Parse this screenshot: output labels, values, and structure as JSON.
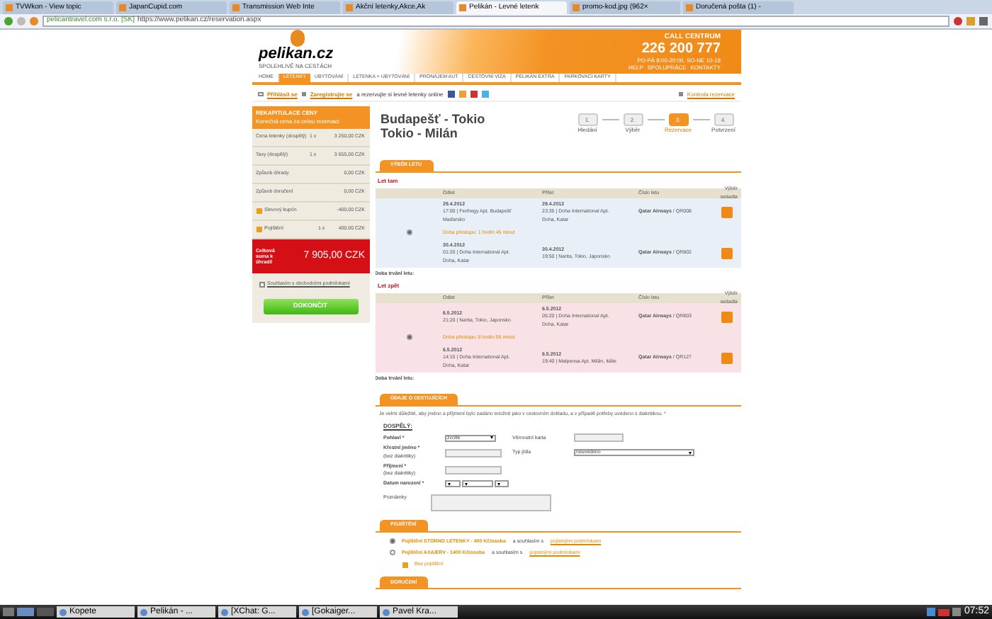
{
  "browser": {
    "tabs": [
      {
        "title": "TVWkon - View topic",
        "selected": false
      },
      {
        "title": "JapanCupid.com",
        "selected": false
      },
      {
        "title": "Transmission Web Inte",
        "selected": false
      },
      {
        "title": "Akční letenky,Akce,Ak",
        "selected": false
      },
      {
        "title": "Pelikán - Levné letenk",
        "selected": true
      },
      {
        "title": "promo-kod.jpg (962×",
        "selected": false
      },
      {
        "title": "Doručená pošta (1) -",
        "selected": false
      }
    ],
    "site_identity": "pelicantravel.com s.r.o. [SK]",
    "url": "https://www.pelikan.cz/reservation.aspx"
  },
  "header": {
    "logo": "pelikan.cz",
    "tagline": "SPOLEHLIVĚ NA CESTÁCH",
    "call_label": "CALL CENTRUM",
    "phone": "226 200 777",
    "hours": "PO-PÁ 8:00-20:00, SO-NE 10-18",
    "links": [
      "HELP",
      "SPOLUPRÁCE",
      "KONTAKTY"
    ]
  },
  "nav": [
    {
      "label": "HOME",
      "selected": false
    },
    {
      "label": "LETENKY",
      "selected": true
    },
    {
      "label": "UBYTOVÁNÍ",
      "selected": false
    },
    {
      "label": "LETENKA + UBYTOVÁNÍ",
      "selected": false
    },
    {
      "label": "PRONÁJEM AUT",
      "selected": false
    },
    {
      "label": "CESTOVNÍ VÍZA",
      "selected": false
    },
    {
      "label": "PELIKÁN EXTRA",
      "selected": false
    },
    {
      "label": "PARKOVACÍ KARTY",
      "selected": false
    }
  ],
  "subbar": {
    "login": "Přihlásit se",
    "register": "Zaregistrujte se",
    "register_text": "a rezervujte si levné letenky online",
    "check": "Kontrola rezervace"
  },
  "summary": {
    "title": "REKAPITULACE CENY",
    "subtitle": "Konečná cena za celou rezervaci",
    "rows": [
      {
        "label": "Cena letenky (dospělý)",
        "qty": "1 x",
        "amount": "3 250,00 CZK",
        "icon": false
      },
      {
        "label": "Taxy (dospělý)",
        "qty": "1 x",
        "amount": "3 655,00 CZK",
        "icon": false
      },
      {
        "label": "Způsob úhrady",
        "amount": "0,00 CZK",
        "icon": false
      },
      {
        "label": "Způsob doručení",
        "amount": "0,00 CZK",
        "icon": false
      },
      {
        "label": "Slevový kupón",
        "amount": "-400,00 CZK",
        "icon": true
      },
      {
        "label": "Pojištění",
        "qty": "1 x",
        "amount": "400,00 CZK",
        "icon": true
      }
    ],
    "total_label": "Celková suma k úhradě",
    "total": "7 905,00 CZK",
    "terms": "Souhlasím s obchodními podmínkami",
    "terms_checked": false,
    "button": "DOKONČIT"
  },
  "route": [
    "Budapešť - Tokio",
    "Tokio - Milán"
  ],
  "steps": [
    {
      "number": "1.",
      "label": "Hledání",
      "selected": false
    },
    {
      "number": "2.",
      "label": "Výběr",
      "selected": false
    },
    {
      "number": "3.",
      "label": "Rezervace",
      "selected": true
    },
    {
      "number": "4.",
      "label": "Potvrzení",
      "selected": false
    }
  ],
  "flight_section": "VÝBĚR LETU",
  "flights": [
    {
      "heading": "Let tam",
      "color": "#e9eff6",
      "selected": true,
      "columns": [
        "Odlet",
        "Přílet",
        "Číslo letu",
        "Výběr sedadla"
      ],
      "segments": [
        {
          "dep_date": "29.4.2012",
          "dep": "17:00 | Ferihegy Apt. Budapešť Maďarsko",
          "arr_date": "29.4.2012",
          "arr": "23:35 | Doha International Apt. Doha, Katar",
          "airline": "Qatar Airways",
          "number": "/ QR008"
        },
        {
          "dep_date": "30.4.2012",
          "dep": "01:20 | Doha International Apt. Doha, Katar",
          "arr_date": "30.4.2012",
          "arr": "19:50 | Narita, Tokio, Japonsko",
          "airline": "Qatar Airways",
          "number": "/ QR802"
        }
      ],
      "transfer": "Doba přestupu: 1 hodin 45 minut",
      "duration": "Doba trvání letu:"
    },
    {
      "heading": "Let zpět",
      "color": "#f9e2e5",
      "selected": true,
      "columns": [
        "Odlet",
        "Přílet",
        "Číslo letu",
        "Výběr sedadla"
      ],
      "segments": [
        {
          "dep_date": "6.5.2012",
          "dep": "21:20 | Narita, Tokio, Japonsko",
          "arr_date": "6.5.2012",
          "arr": "05:20 | Doha International Apt. Doha, Katar",
          "airline": "Qatar Airways",
          "number": "/ QR803"
        },
        {
          "dep_date": "6.5.2012",
          "dep": "14:15 | Doha International Apt. Doha, Katar",
          "arr_date": "6.5.2012",
          "arr": "19:40 | Malpensa Apt. Milán, Itálie",
          "airline": "Qatar Airways",
          "number": "/ QR127"
        }
      ],
      "transfer": "Doba přestupu: 8 hodin 55 minut",
      "duration": "Doba trvání letu:"
    }
  ],
  "passenger_section": "ÚDAJE O CESTUJÍCÍCH",
  "note": "Je velmi důležité, aby jméno a příjmení bylo zadáno totožně jako v cestovním dokladu, a v případě potřeby uvedeno s diakritikou. *",
  "passenger_type": "DOSPĚLÝ:",
  "form": {
    "gender_label": "Pohlaví *",
    "gender_value": "zvolte",
    "first_label": "Křestní jméno *",
    "first_hint": "(bez diakritiky)",
    "last_label": "Příjmení *",
    "last_hint": "(bez diakritiky)",
    "birth_label": "Datum narození *",
    "card_label": "Věrnostní karta",
    "meal_label": "Typ jídla",
    "meal_value": "neuvedeno",
    "notes_label": "Poznámky"
  },
  "insurance_section": "POJIŠTĚNÍ",
  "insurance": [
    {
      "kind": "radio",
      "text": "Pojištění STORNO LETENKY - 400 Kč/osoba",
      "suffix": "a souhlasím s",
      "link": "pojistnými podmínkami",
      "selected": true
    },
    {
      "kind": "radio",
      "text": "Pojištění AXA/ERV - 1400 Kč/osoba",
      "suffix": "a souhlasím s",
      "link": "pojistnými podmínkami",
      "selected": false
    },
    {
      "kind": "icon",
      "text": "Bez pojištění"
    }
  ],
  "next_section": "DORUČENÍ",
  "taskbar": {
    "items": [
      "Kopete",
      "Pelikán - ...",
      "[XChat: G...",
      "[Gokaiger...",
      "Pavel Kra..."
    ],
    "clock": "07:52"
  }
}
